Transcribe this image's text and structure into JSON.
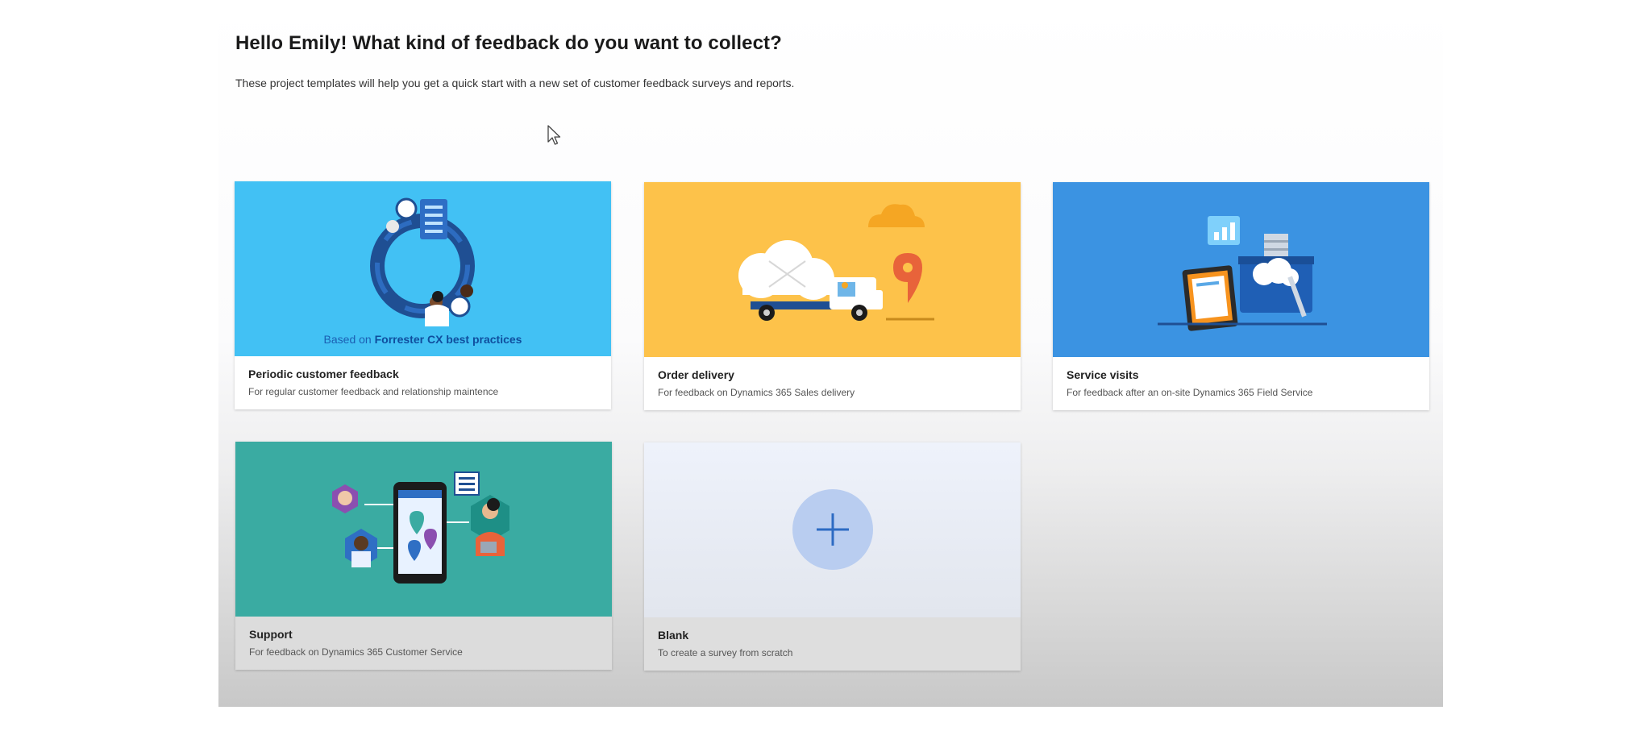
{
  "header": {
    "title": "Hello Emily! What kind of feedback do you want to collect?",
    "subtitle": "These project templates will help you get a quick start with a new set of customer feedback surveys and reports."
  },
  "colors": {
    "periodic_bg": "#42c1f4",
    "order_bg": "#fdc24a",
    "service_bg": "#3b93e2",
    "support_bg": "#3aaba2",
    "blank_bg": "#e7ebf2",
    "accent": "#1b5fb3"
  },
  "templates": [
    {
      "id": "periodic",
      "title": "Periodic customer feedback",
      "description": "For regular customer feedback and relationship maintence",
      "badge_prefix": "Based on ",
      "badge_highlight": "Forrester CX best practices",
      "icon": "feedback-cycle-illustration"
    },
    {
      "id": "order",
      "title": "Order delivery",
      "description": "For feedback on Dynamics 365 Sales delivery",
      "icon": "delivery-truck-illustration"
    },
    {
      "id": "service",
      "title": "Service visits",
      "description": "For feedback after an on-site Dynamics 365 Field Service",
      "icon": "service-toolbox-illustration"
    },
    {
      "id": "support",
      "title": "Support",
      "description": "For feedback on Dynamics 365 Customer Service",
      "icon": "support-phone-illustration"
    },
    {
      "id": "blank",
      "title": "Blank",
      "description": "To create a survey from scratch",
      "icon": "plus-icon"
    }
  ]
}
